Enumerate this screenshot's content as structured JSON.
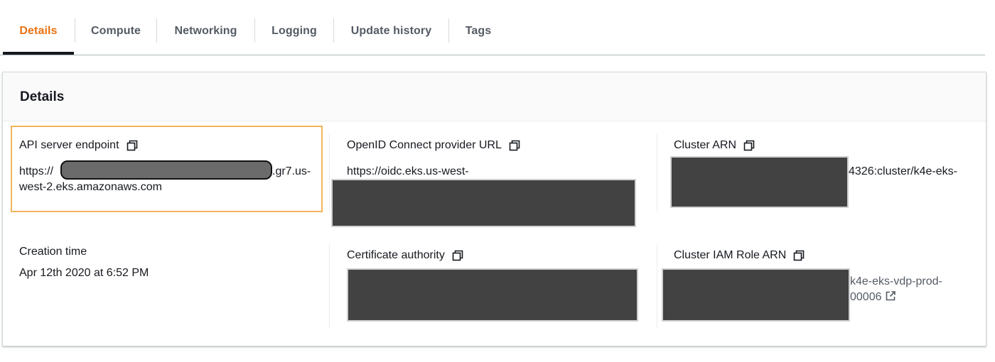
{
  "tabs": [
    {
      "label": "Details",
      "active": true
    },
    {
      "label": "Compute",
      "active": false
    },
    {
      "label": "Networking",
      "active": false
    },
    {
      "label": "Logging",
      "active": false
    },
    {
      "label": "Update history",
      "active": false
    },
    {
      "label": "Tags",
      "active": false
    }
  ],
  "panel": {
    "title": "Details"
  },
  "fields": {
    "api_endpoint": {
      "label": "API server endpoint",
      "value_prefix": "https://",
      "value_suffix": ".gr7.us-",
      "value_line2": "west-2.eks.amazonaws.com"
    },
    "oidc": {
      "label": "OpenID Connect provider URL",
      "value": "https://oidc.eks.us-west-"
    },
    "cluster_arn": {
      "label": "Cluster ARN",
      "value_visible": "4326:cluster/k4e-eks-"
    },
    "creation_time": {
      "label": "Creation time",
      "value": "Apr 12th 2020 at 6:52 PM"
    },
    "certificate_authority": {
      "label": "Certificate authority"
    },
    "iam_role": {
      "label": "Cluster IAM Role ARN",
      "value_line1": "k4e-eks-vdp-prod-",
      "value_line2": "00006"
    }
  },
  "colors": {
    "active_tab": "#ec7211",
    "text": "#16191f",
    "highlight": "#f2b45b",
    "redaction": "#424242"
  },
  "icons": {
    "copy": "copy-icon",
    "external_link": "external-link-icon"
  }
}
